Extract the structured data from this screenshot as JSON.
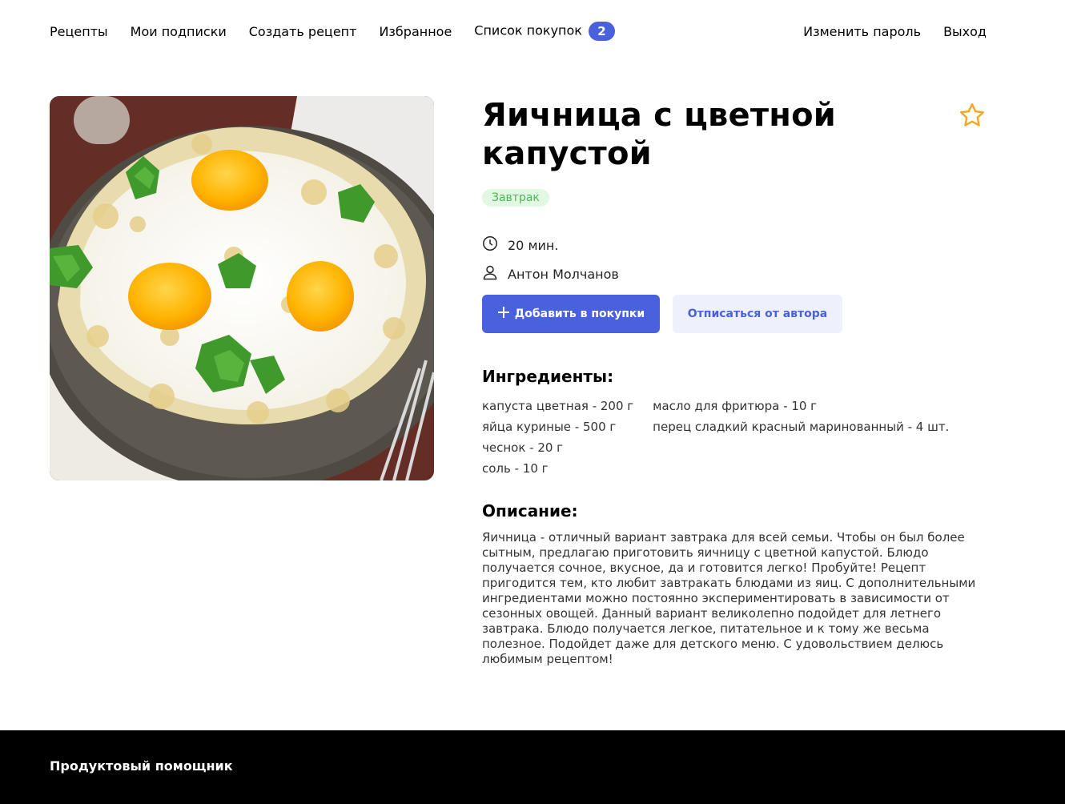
{
  "nav": {
    "recipes": "Рецепты",
    "subscriptions": "Мои подписки",
    "create_recipe": "Создать рецепт",
    "favorites": "Избранное",
    "shopping_list": "Список покупок",
    "shopping_count": "2",
    "change_password": "Изменить пароль",
    "logout": "Выход"
  },
  "recipe": {
    "title": "Яичница с цветной капустой",
    "tag": "Завтрак",
    "tag_color": "#49b64e",
    "cook_time": "20 мин.",
    "author": "Антон Молчанов",
    "add_to_cart_label": "Добавить в покупки",
    "unsubscribe_label": "Отписаться от автора",
    "ingredients_title": "Ингредиенты:",
    "ingredients_col1": [
      "капуста цветная - 200 г",
      "яйца куриные - 500 г",
      "чеснок - 20 г",
      "соль - 10 г"
    ],
    "ingredients_col2": [
      "масло для фритюра - 10 г",
      "перец сладкий красный маринованный - 4 шт."
    ],
    "description_title": "Описание:",
    "description": "Яичница - отличный вариант завтрака для всей семьи. Чтобы он был более сытным, предлагаю приготовить яичницу с цветной капустой. Блюдо получается сочное, вкусное, да и готовится легко! Пробуйте! Рецепт пригодится тем, кто любит завтракать блюдами из яиц. С дополнительными ингредиентами можно постоянно экспериментировать в зависимости от сезонных овощей. Данный вариант великолепно подойдет для летнего завтрака. Блюдо получается легкое, питательное и к тому же весьма полезное. Подойдет даже для детского меню. С удовольствием делюсь любимым рецептом!"
  },
  "footer": {
    "brand": "Продуктовый помощник"
  },
  "colors": {
    "accent": "#4a61dd",
    "favorite_star": "#f5a623"
  },
  "icons": {
    "favorite": "star-icon",
    "time": "clock-icon",
    "author": "user-icon",
    "add": "plus-icon"
  }
}
